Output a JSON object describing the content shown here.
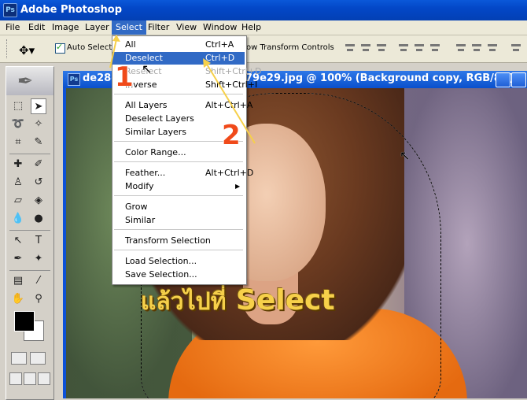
{
  "app": {
    "title": "Adobe Photoshop",
    "logo": "Ps"
  },
  "menubar": {
    "items": [
      "File",
      "Edit",
      "Image",
      "Layer",
      "Select",
      "Filter",
      "View",
      "Window",
      "Help"
    ],
    "active": "Select"
  },
  "options": {
    "auto_select": "Auto Select L",
    "show_transform": "ow Transform Controls"
  },
  "document": {
    "title": "de28d",
    "title_tail": "79e29.jpg @ 100% (Background copy, RGB/8#)",
    "icon": "Ps"
  },
  "select_menu": {
    "items": [
      {
        "label": "All",
        "shortcut": "Ctrl+A",
        "state": "normal"
      },
      {
        "label": "Deselect",
        "shortcut": "Ctrl+D",
        "state": "highlighted"
      },
      {
        "label": "Reselect",
        "shortcut": "Shift+Ctrl+D",
        "state": "disabled"
      },
      {
        "label": "Inverse",
        "shortcut": "Shift+Ctrl+I",
        "state": "normal"
      },
      {
        "label": "All Layers",
        "shortcut": "Alt+Ctrl+A",
        "state": "normal"
      },
      {
        "label": "Deselect Layers",
        "shortcut": "",
        "state": "normal"
      },
      {
        "label": "Similar Layers",
        "shortcut": "",
        "state": "normal"
      },
      {
        "label": "Color Range...",
        "shortcut": "",
        "state": "normal"
      },
      {
        "label": "Feather...",
        "shortcut": "Alt+Ctrl+D",
        "state": "normal"
      },
      {
        "label": "Modify",
        "shortcut": "",
        "state": "submenu"
      },
      {
        "label": "Grow",
        "shortcut": "",
        "state": "normal"
      },
      {
        "label": "Similar",
        "shortcut": "",
        "state": "normal"
      },
      {
        "label": "Transform Selection",
        "shortcut": "",
        "state": "normal"
      },
      {
        "label": "Load Selection...",
        "shortcut": "",
        "state": "normal"
      },
      {
        "label": "Save Selection...",
        "shortcut": "",
        "state": "normal"
      }
    ]
  },
  "annotations": {
    "step1": "1",
    "step2": "2",
    "caption_thai": "แล้วไปที่",
    "caption_en": "Select"
  },
  "colors": {
    "accent": "#316ac5",
    "title_blue": "#0a50cc",
    "annotation_red": "#f04a1a",
    "caption_gold": "#f6d04a"
  }
}
